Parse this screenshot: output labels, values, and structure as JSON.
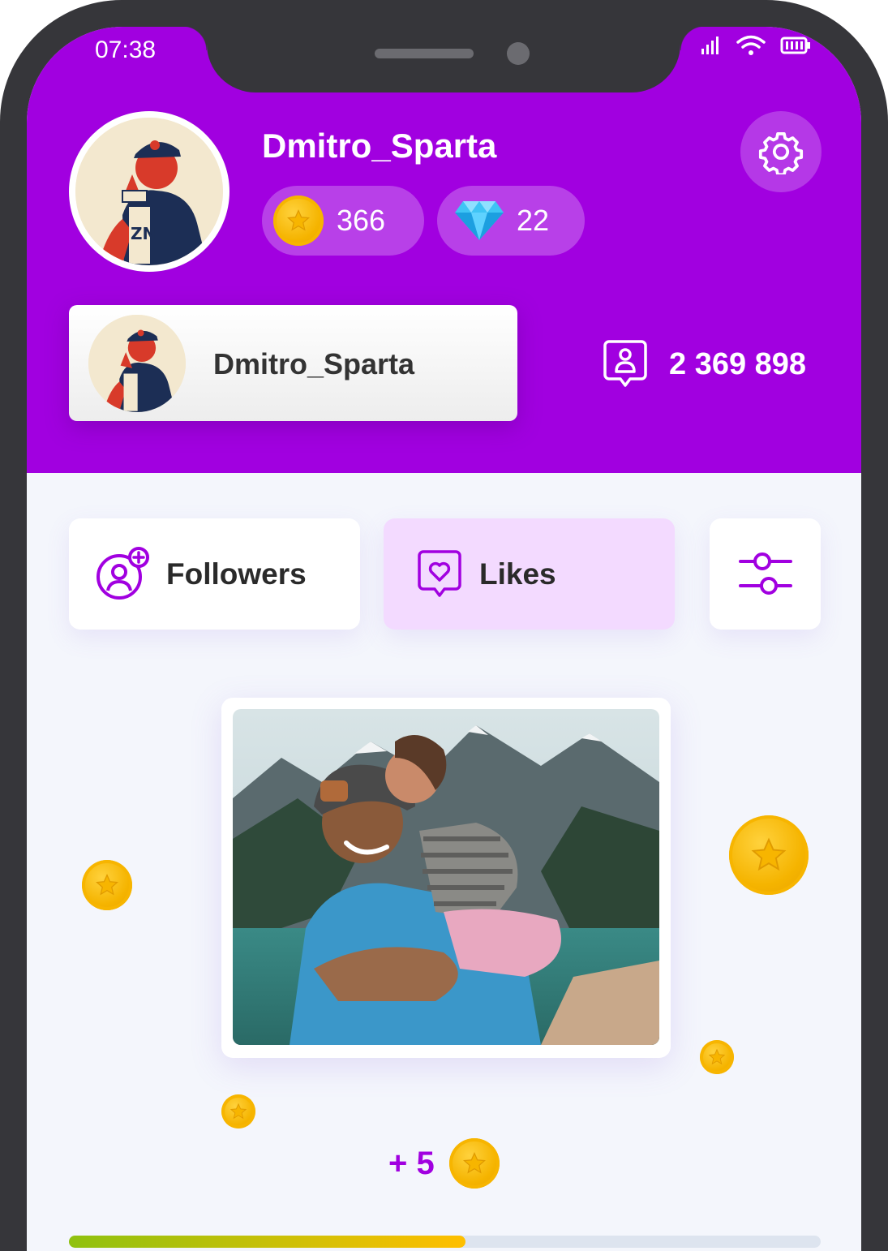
{
  "status_bar": {
    "time": "07:38"
  },
  "profile": {
    "username": "Dmitro_Sparta",
    "coins": "366",
    "gems": "22",
    "card_name": "Dmitro_Sparta",
    "followers_count": "2 369 898"
  },
  "tabs": [
    {
      "label": "Followers",
      "icon": "user-plus-icon",
      "active": false
    },
    {
      "label": "Likes",
      "icon": "heart-icon",
      "active": true
    },
    {
      "label": "",
      "icon": "sliders-icon",
      "active": false
    }
  ],
  "reward": {
    "text": "+ 5"
  },
  "progress": {
    "fraction": 0.527
  },
  "colors": {
    "brand_purple": "#a100e0",
    "likes_tab_bg": "#f3daff",
    "coin_gold": "#f5b400",
    "progress_start": "#8fc10f",
    "progress_end": "#ffbf00"
  }
}
